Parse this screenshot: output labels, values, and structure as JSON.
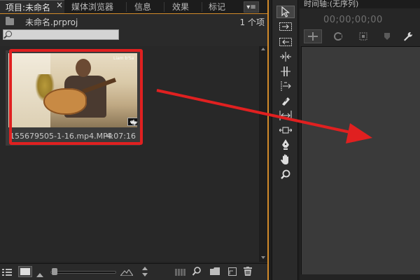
{
  "project_panel": {
    "tabs": [
      {
        "label": "项目:未命名",
        "active": true,
        "closable": true
      },
      {
        "label": "媒体浏览器",
        "active": false
      },
      {
        "label": "信息",
        "active": false
      },
      {
        "label": "效果",
        "active": false
      },
      {
        "label": "标记",
        "active": false
      }
    ],
    "close_glyph": "×",
    "menu_label": "▾≡",
    "project_name": "未命名.prproj",
    "item_count": "1 个项",
    "search": {
      "value": "",
      "placeholder": ""
    },
    "clip": {
      "name": "155679505-1-16.mp4.MP4",
      "duration": "4:07:16",
      "watermark": "Liam b'Sa",
      "has_audio_badge": true
    },
    "toolbar_icons": [
      "list-view-icon",
      "icon-view-icon",
      "zoom-out-mountain-icon",
      "zoom-slider",
      "zoom-in-mountain-icon",
      "sort-icon",
      "automate-to-sequence-icon",
      "find-icon",
      "new-bin-icon",
      "new-item-icon",
      "delete-icon"
    ]
  },
  "tools_panel": {
    "tools": [
      {
        "name": "selection-tool",
        "glyph": "↖",
        "selected": true
      },
      {
        "name": "track-select-tool",
        "glyph": "⇥"
      },
      {
        "name": "track-select-back-tool",
        "glyph": "⇤"
      },
      {
        "name": "ripple-edit-tool",
        "glyph": "⇹"
      },
      {
        "name": "rolling-edit-tool",
        "glyph": "#"
      },
      {
        "name": "rate-stretch-tool",
        "glyph": "⇢"
      },
      {
        "name": "razor-tool",
        "glyph": "✎"
      },
      {
        "name": "slip-tool",
        "glyph": "↔"
      },
      {
        "name": "slide-tool",
        "glyph": "⇔"
      },
      {
        "name": "pen-tool",
        "glyph": "✒"
      },
      {
        "name": "hand-tool",
        "glyph": "✋"
      },
      {
        "name": "zoom-tool",
        "glyph": "🔍"
      }
    ]
  },
  "timeline_panel": {
    "tab_label": "时间轴:(无序列)",
    "timecode": "00;00;00;00",
    "tool_buttons": [
      "snap-icon",
      "linked-selection-icon",
      "add-marker-icon",
      "marker-icon",
      "wrench-icon"
    ]
  },
  "colors": {
    "accent_orange": "#d18a2a",
    "annotation_red": "#e02020",
    "panel_bg": "#232323",
    "timeline_body": "#3a3a3a"
  }
}
